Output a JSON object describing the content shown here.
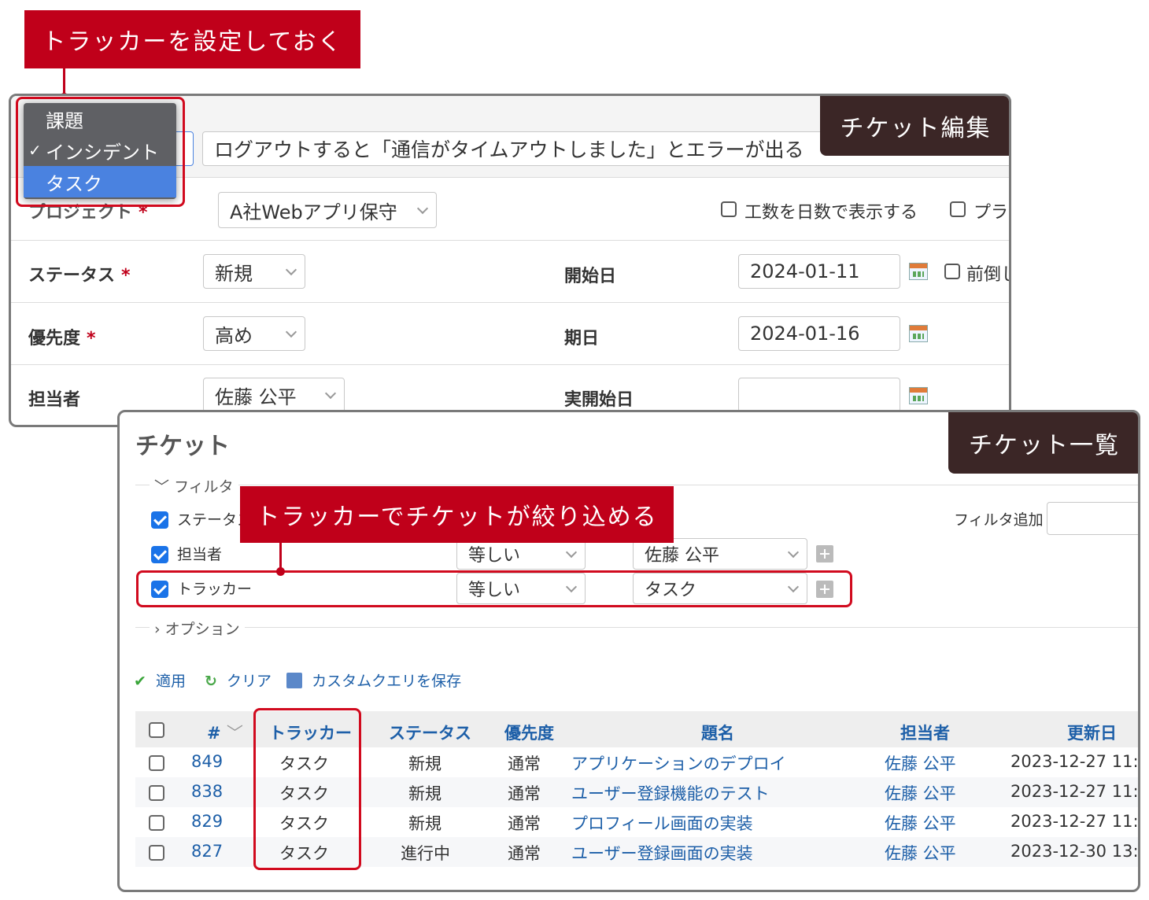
{
  "annotations": {
    "set_tracker": "トラッカーを設定しておく",
    "filter_by_tracker": "トラッカーでチケットが絞り込める",
    "edit_label": "チケット編集",
    "list_label": "チケット一覧"
  },
  "edit": {
    "tracker_options": [
      "課題",
      "インシデント",
      "タスク"
    ],
    "tracker_checked": "✓",
    "subject_value": "ログアウトすると「通信がタイムアウトしました」とエラーが出る",
    "project_label": "プロジェクト",
    "project_value": "A社Webアプリ保守",
    "days_checkbox_label": "工数を日数で表示する",
    "plan_checkbox_label": "プラ",
    "required_mark": "*",
    "status_label": "ステータス",
    "status_value": "新規",
    "priority_label": "優先度",
    "priority_value": "高め",
    "assignee_label": "担当者",
    "assignee_value": "佐藤 公平",
    "start_date_label": "開始日",
    "start_date_value": "2024-01-11",
    "front_checkbox_label": "前倒し",
    "due_date_label": "期日",
    "due_date_value": "2024-01-16",
    "actual_start_label": "実開始日",
    "actual_start_value": ""
  },
  "list": {
    "title": "チケット",
    "filter_section": "フィルタ",
    "option_section": "オプション",
    "add_filter_label": "フィルタ追加",
    "filters": [
      {
        "field": "ステータス",
        "operator": "",
        "value": ""
      },
      {
        "field": "担当者",
        "operator": "等しい",
        "value": "佐藤 公平"
      },
      {
        "field": "トラッカー",
        "operator": "等しい",
        "value": "タスク"
      }
    ],
    "actions": {
      "apply": "適用",
      "clear": "クリア",
      "save": "カスタムクエリを保存"
    },
    "columns": [
      "#",
      "トラッカー",
      "ステータス",
      "優先度",
      "題名",
      "担当者",
      "更新日"
    ],
    "rows": [
      {
        "id": "849",
        "tracker": "タスク",
        "status": "新規",
        "priority": "通常",
        "subject": "アプリケーションのデプロイ",
        "assignee": "佐藤 公平",
        "updated": "2023-12-27 11:"
      },
      {
        "id": "838",
        "tracker": "タスク",
        "status": "新規",
        "priority": "通常",
        "subject": "ユーザー登録機能のテスト",
        "assignee": "佐藤 公平",
        "updated": "2023-12-27 11:"
      },
      {
        "id": "829",
        "tracker": "タスク",
        "status": "新規",
        "priority": "通常",
        "subject": "プロフィール画面の実装",
        "assignee": "佐藤 公平",
        "updated": "2023-12-27 11:"
      },
      {
        "id": "827",
        "tracker": "タスク",
        "status": "進行中",
        "priority": "通常",
        "subject": "ユーザー登録画面の実装",
        "assignee": "佐藤 公平",
        "updated": "2023-12-30 13:"
      }
    ]
  },
  "colors": {
    "accent_red": "#c0001a",
    "link_blue": "#1d5fa8",
    "dark_label": "#3b2626"
  }
}
